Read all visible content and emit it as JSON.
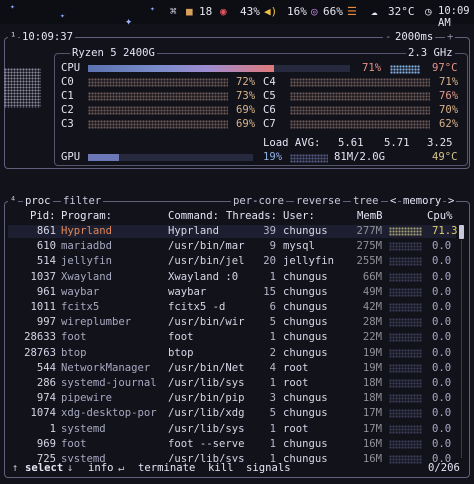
{
  "bar": {
    "battery": "18",
    "volume_pct": "43%",
    "brightness": "16%",
    "memory_pct": "66%",
    "temperature": "32°C",
    "clock": "10:09 AM"
  },
  "cpu": {
    "clock": "10:09:37",
    "update_interval": "2000ms",
    "model": "Ryzen 5 2400G",
    "freq": "2.3 GHz",
    "total_label": "CPU",
    "total_pct": "71%",
    "total_temp": "97°C",
    "total_value": 71,
    "cores": [
      {
        "label": "C0",
        "pct": "72%"
      },
      {
        "label": "C1",
        "pct": "73%"
      },
      {
        "label": "C2",
        "pct": "69%"
      },
      {
        "label": "C3",
        "pct": "69%"
      },
      {
        "label": "C4",
        "pct": "71%"
      },
      {
        "label": "C5",
        "pct": "76%"
      },
      {
        "label": "C6",
        "pct": "70%"
      },
      {
        "label": "C7",
        "pct": "62%"
      }
    ],
    "load_label": "Load AVG:",
    "load_1": "5.61",
    "load_5": "5.71",
    "load_15": "3.25",
    "gpu_label": "GPU",
    "gpu_pct": "19%",
    "gpu_value": 19,
    "gpu_mem": "81M/2.0G",
    "gpu_temp": "49°C",
    "battery_marker": "¹"
  },
  "proc": {
    "tab_marker": "⁴",
    "tab_proc": "proc",
    "tab_filter": "filter",
    "tab_percore": "per-core",
    "tab_reverse": "reverse",
    "tab_tree": "tree",
    "sort_prev": "<",
    "sort_field": "memory",
    "sort_next": ">",
    "col_pid": "Pid:",
    "col_program": "Program:",
    "col_command": "Command:",
    "col_threads": "Threads:",
    "col_user": "User:",
    "col_mem": "MemB",
    "col_cpu": "Cpu%",
    "rows": [
      {
        "pid": "861",
        "program": "Hyprland",
        "command": "Hyprland",
        "threads": "39",
        "user": "chungus",
        "mem": "277M",
        "cpu": "71.3"
      },
      {
        "pid": "610",
        "program": "mariadbd",
        "command": "/usr/bin/mar",
        "threads": "9",
        "user": "mysql",
        "mem": "275M",
        "cpu": "0.0"
      },
      {
        "pid": "514",
        "program": "jellyfin",
        "command": "/usr/bin/jel",
        "threads": "20",
        "user": "jellyfin",
        "mem": "255M",
        "cpu": "0.0"
      },
      {
        "pid": "1037",
        "program": "Xwayland",
        "command": "Xwayland :0",
        "threads": "1",
        "user": "chungus",
        "mem": "66M",
        "cpu": "0.0"
      },
      {
        "pid": "961",
        "program": "waybar",
        "command": "waybar",
        "threads": "15",
        "user": "chungus",
        "mem": "49M",
        "cpu": "0.0"
      },
      {
        "pid": "1011",
        "program": "fcitx5",
        "command": "fcitx5 -d",
        "threads": "6",
        "user": "chungus",
        "mem": "42M",
        "cpu": "0.0"
      },
      {
        "pid": "997",
        "program": "wireplumber",
        "command": "/usr/bin/wir",
        "threads": "5",
        "user": "chungus",
        "mem": "28M",
        "cpu": "0.0"
      },
      {
        "pid": "28633",
        "program": "foot",
        "command": "foot",
        "threads": "1",
        "user": "chungus",
        "mem": "22M",
        "cpu": "0.0"
      },
      {
        "pid": "28763",
        "program": "btop",
        "command": "btop",
        "threads": "2",
        "user": "chungus",
        "mem": "19M",
        "cpu": "0.0"
      },
      {
        "pid": "544",
        "program": "NetworkManager",
        "command": "/usr/bin/Net",
        "threads": "4",
        "user": "root",
        "mem": "19M",
        "cpu": "0.0"
      },
      {
        "pid": "286",
        "program": "systemd-journal",
        "command": "/usr/lib/sys",
        "threads": "1",
        "user": "root",
        "mem": "18M",
        "cpu": "0.0"
      },
      {
        "pid": "974",
        "program": "pipewire",
        "command": "/usr/bin/pip",
        "threads": "3",
        "user": "chungus",
        "mem": "18M",
        "cpu": "0.0"
      },
      {
        "pid": "1074",
        "program": "xdg-desktop-por",
        "command": "/usr/lib/xdg",
        "threads": "5",
        "user": "chungus",
        "mem": "17M",
        "cpu": "0.0"
      },
      {
        "pid": "1",
        "program": "systemd",
        "command": "/usr/lib/sys",
        "threads": "1",
        "user": "root",
        "mem": "17M",
        "cpu": "0.0"
      },
      {
        "pid": "969",
        "program": "foot",
        "command": "foot --serve",
        "threads": "1",
        "user": "chungus",
        "mem": "16M",
        "cpu": "0.0"
      },
      {
        "pid": "725",
        "program": "systemd",
        "command": "/usr/lib/sys",
        "threads": "1",
        "user": "chungus",
        "mem": "16M",
        "cpu": "0.0"
      }
    ],
    "foot_select": "select",
    "foot_info": "info",
    "foot_terminate": "terminate",
    "foot_kill": "kill",
    "foot_signals": "signals",
    "count": "0/206"
  }
}
